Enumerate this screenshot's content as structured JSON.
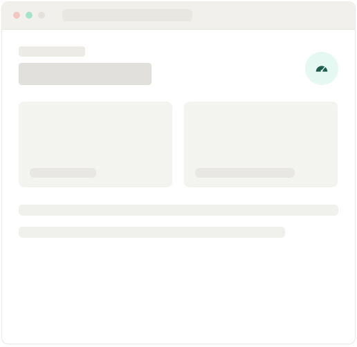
{
  "window": {
    "traffic_lights": {
      "close_color": "#f2c7c2",
      "maximize_color": "#a6e3cd",
      "minimize_color": "#e2e1dc"
    },
    "address_bar": {
      "text": ""
    }
  },
  "header": {
    "label": "",
    "title": "",
    "badge": {
      "icon": "speedometer-icon",
      "background": "#e6f8f2",
      "icon_color": "#1f5e4c"
    }
  },
  "cards": [
    {
      "caption": ""
    },
    {
      "caption": ""
    }
  ],
  "text_lines": [
    "",
    ""
  ]
}
